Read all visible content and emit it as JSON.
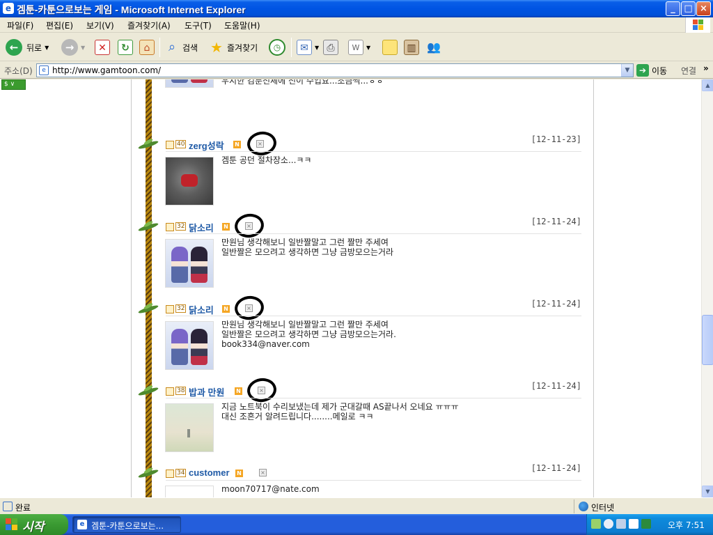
{
  "window": {
    "title": "겜툰-카툰으로보는 게임 - Microsoft Internet Explorer",
    "controls": [
      "_",
      "□",
      "×"
    ]
  },
  "menu": [
    "파일(F)",
    "편집(E)",
    "보기(V)",
    "즐겨찾기(A)",
    "도구(T)",
    "도움말(H)"
  ],
  "toolbar": {
    "back_label": "뒤로",
    "search_label": "검색",
    "favorites_label": "즐겨찾기"
  },
  "address": {
    "label": "주소(D)",
    "url": "http://www.gamtoon.com/",
    "go_label": "이동",
    "links_label": "연결"
  },
  "partial_top_text": "우지한 검툰전체에 전이 수입요...조금씩...ㅎㅎ",
  "comments": [
    {
      "level": "40",
      "nick": "zerg성락",
      "date": "[12-11-23]",
      "avatar": "dark",
      "lines": [
        "겜툰 공던 절차장소...ㅋㅋ"
      ]
    },
    {
      "level": "32",
      "nick": "닭소리",
      "date": "[12-11-24]",
      "avatar": "anime",
      "lines": [
        "만원님 생각해보니 일반짤말고 그런 짤만 주세여",
        "일반짤은 모으려고 생각하면 그냥 금방모으는거라"
      ]
    },
    {
      "level": "32",
      "nick": "닭소리",
      "date": "[12-11-24]",
      "avatar": "anime",
      "lines": [
        "만원님 생각해보니 일반짤말고 그런 짤만 주세여",
        "일반짤은 모으려고 생각하면 그냥 금방모으는거라.",
        "book334@naver.com"
      ]
    },
    {
      "level": "38",
      "nick": "밥과 만원",
      "date": "[12-11-24]",
      "avatar": "sky",
      "lines": [
        "지금 노트북이 수리보냈는데 제가 군대갈때 AS끝나서 오네요 ㅠㅠㅠ",
        "대신 조흔거 알려드립니다........메일로 ㅋㅋ"
      ]
    },
    {
      "level": "34",
      "nick": "customer",
      "date": "[12-11-24]",
      "avatar": "blue",
      "lines": [
        "moon70717@nate.com"
      ]
    }
  ],
  "badges": {
    "new": "N",
    "delete": "×"
  },
  "status": {
    "text": "완료",
    "zone": "인터넷"
  },
  "taskbar": {
    "start_label": "시작",
    "task_label": "겜툰-카툰으로보는...",
    "clock": "오후 7:51"
  },
  "colors": {
    "nick": "#1F5AA6",
    "title_bar": "#0054E3",
    "start_button": "#3A9A32"
  }
}
